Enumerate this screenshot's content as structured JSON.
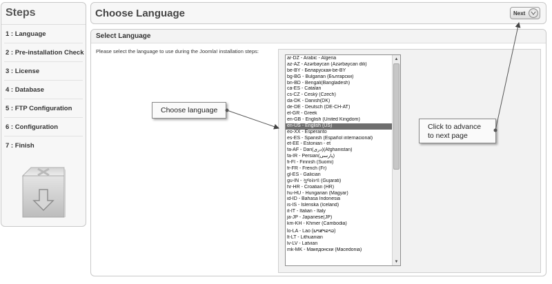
{
  "sidebar": {
    "title": "Steps",
    "steps": [
      "1 : Language",
      "2 : Pre-installation Check",
      "3 : License",
      "4 : Database",
      "5 : FTP Configuration",
      "6 : Configuration",
      "7 : Finish"
    ]
  },
  "header": {
    "title": "Choose Language",
    "next_label": "Next"
  },
  "main": {
    "section_title": "Select Language",
    "instruction": "Please select the language to use during the Joomla! installation steps:",
    "languages": [
      "ar-DZ - Arabic - Algeria",
      "az-AZ - Azərbaycan (Azərbaycan dili)",
      "be-BY - Беларуская-be-BY",
      "bg-BG - Bulgarian (Български)",
      "bn-BD - Bengali(Bangladesh)",
      "ca-ES - Catalan",
      "cs-CZ - Český (Czech)",
      "da-DK - Danish(DK)",
      "de-DE - Deutsch (DE-CH-AT)",
      "el-GR - Greek",
      "en-GB - English (United Kingdom)",
      "en-US - English (US)",
      "eo-XX - Esperanto",
      "es-ES - Spanish (Español internacional)",
      "et-EE - Estonian - et",
      "fa-AF - Dari(دری)(Afghanistan)",
      "fa-IR - Persian(پارسی)",
      "fi-FI - Finnish (Suomi)",
      "fr-FR - French (Fr)",
      "gl-ES - Galician",
      "gu-IN - ગુજરાતી (Gujarati)",
      "hr-HR - Croatian (HR)",
      "hu-HU - Hungarian (Magyar)",
      "id-ID - Bahasa Indonesia",
      "is-IS - Íslenska (Iceland)",
      "it-IT - Italian - Italy",
      "ja-JP - Japanese(JP)",
      "km-KH - Khmer (Cambodia)",
      "lo-LA - Lao (ພາສາລາວ)",
      "lt-LT - Lithuanian",
      "lv-LV - Latvian",
      "mk-MK - Македонски (Macedonia)"
    ],
    "selected_language": "en-US - English (US)"
  },
  "callouts": {
    "choose_language": "Choose language",
    "advance_line1": "Click to  advance",
    "advance_line2": "to next page"
  },
  "icons": {
    "next": "chevron-circle-icon",
    "install_box": "joomla-box-download-icon"
  }
}
